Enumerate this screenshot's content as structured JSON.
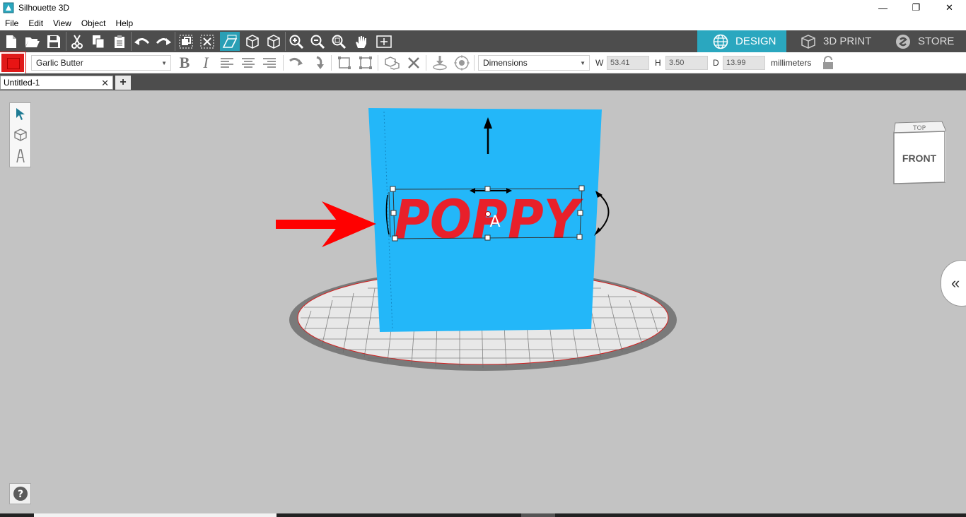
{
  "window": {
    "title": "Silhouette 3D",
    "minimize": "—",
    "restore": "❐",
    "close": "✕"
  },
  "menu": [
    "File",
    "Edit",
    "View",
    "Object",
    "Help"
  ],
  "mode_tabs": {
    "design": "DESIGN",
    "print3d": "3D PRINT",
    "store": "STORE"
  },
  "text_toolbar": {
    "font": "Garlic Butter",
    "mode_select": "Dimensions",
    "w_label": "W",
    "w_value": "53.41",
    "h_label": "H",
    "h_value": "3.50",
    "d_label": "D",
    "d_value": "13.99",
    "units": "millimeters"
  },
  "document_tab": {
    "name": "Untitled-1",
    "close": "✕",
    "add": "+"
  },
  "canvas": {
    "text_object": "POPPY",
    "anchor_marker": "A",
    "viewcube_face": "FRONT",
    "viewcube_top": "TOP"
  },
  "colors": {
    "accent": "#2aa7bf",
    "object_fill": "#23b7f9",
    "text_fill": "#e8202a",
    "selection_color": "#e01a1a",
    "arrow_annotation": "#ff0000"
  },
  "icons": {
    "help": "?",
    "collapse": "«"
  }
}
